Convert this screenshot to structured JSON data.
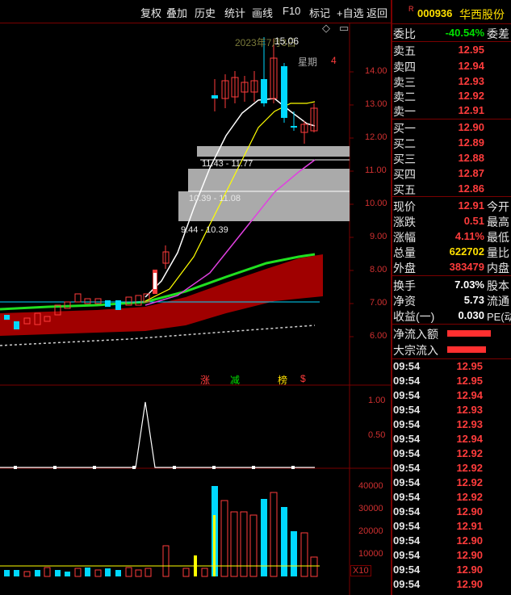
{
  "toolbar": {
    "buttons": [
      "复权",
      "叠加",
      "历史",
      "统计",
      "画线",
      "F10",
      "标记",
      "+自选",
      "返回"
    ]
  },
  "chart": {
    "date_label": "2023年7月3日",
    "weekday_label": "星期",
    "weekday_num": "4",
    "high_label": "15.06",
    "price_ticks": [
      "14.00",
      "13.00",
      "12.00",
      "11.00",
      "10.00",
      "9.00",
      "8.00",
      "7.00",
      "6.00"
    ],
    "zone_labels": [
      "11.43 - 11.77",
      "10.39 - 11.08",
      "9.44 - 10.39"
    ],
    "signal_labels": [
      "涨",
      "减",
      "榜",
      "$"
    ],
    "indicator_ticks": [
      "1.00",
      "0.50"
    ],
    "volume_ticks": [
      "40000",
      "30000",
      "20000",
      "10000"
    ],
    "volume_unit": "X10",
    "colors": {
      "up": "#ff3c3c",
      "down": "#00e0ff",
      "ma5": "#ffffff",
      "ma10": "#ffff00",
      "ma20": "#e040e0",
      "band": "#a00000"
    }
  },
  "panel": {
    "code": "000936",
    "name": "华西股份",
    "badge": "R",
    "weibi_label": "委比",
    "weibi_value": "-40.54%",
    "weicha_label": "委差",
    "asks": [
      {
        "label": "卖五",
        "price": "12.95"
      },
      {
        "label": "卖四",
        "price": "12.94"
      },
      {
        "label": "卖三",
        "price": "12.93"
      },
      {
        "label": "卖二",
        "price": "12.92"
      },
      {
        "label": "卖一",
        "price": "12.91"
      }
    ],
    "bids": [
      {
        "label": "买一",
        "price": "12.90"
      },
      {
        "label": "买二",
        "price": "12.89"
      },
      {
        "label": "买三",
        "price": "12.88"
      },
      {
        "label": "买四",
        "price": "12.87"
      },
      {
        "label": "买五",
        "price": "12.86"
      }
    ],
    "stats": [
      {
        "label": "现价",
        "value": "12.91",
        "color": "red",
        "right": "今开"
      },
      {
        "label": "涨跌",
        "value": "0.51",
        "color": "red",
        "right": "最高"
      },
      {
        "label": "涨幅",
        "value": "4.11%",
        "color": "red",
        "right": "最低"
      },
      {
        "label": "总量",
        "value": "622702",
        "color": "yellow",
        "right": "量比"
      },
      {
        "label": "外盘",
        "value": "383479",
        "color": "red",
        "right": "内盘"
      }
    ],
    "stats2": [
      {
        "label": "换手",
        "value": "7.03%",
        "right": "股本"
      },
      {
        "label": "净资",
        "value": "5.73",
        "right": "流通"
      },
      {
        "label": "收益(一)",
        "value": "0.030",
        "right": "PE(动"
      }
    ],
    "flow": [
      {
        "label": "净流入额"
      },
      {
        "label": "大宗流入"
      }
    ],
    "ticks": [
      {
        "time": "09:54",
        "price": "12.95"
      },
      {
        "time": "09:54",
        "price": "12.95"
      },
      {
        "time": "09:54",
        "price": "12.94"
      },
      {
        "time": "09:54",
        "price": "12.93"
      },
      {
        "time": "09:54",
        "price": "12.93"
      },
      {
        "time": "09:54",
        "price": "12.94"
      },
      {
        "time": "09:54",
        "price": "12.92"
      },
      {
        "time": "09:54",
        "price": "12.92"
      },
      {
        "time": "09:54",
        "price": "12.92"
      },
      {
        "time": "09:54",
        "price": "12.92"
      },
      {
        "time": "09:54",
        "price": "12.90"
      },
      {
        "time": "09:54",
        "price": "12.91"
      },
      {
        "time": "09:54",
        "price": "12.90"
      },
      {
        "time": "09:54",
        "price": "12.90"
      },
      {
        "time": "09:54",
        "price": "12.90"
      },
      {
        "time": "09:54",
        "price": "12.90"
      }
    ]
  }
}
